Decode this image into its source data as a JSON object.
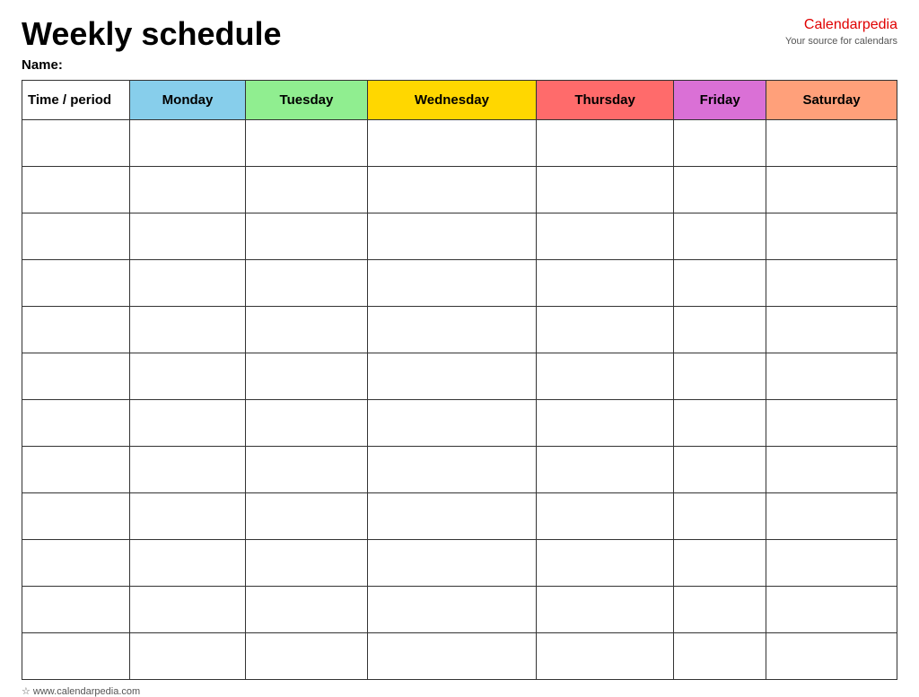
{
  "header": {
    "title": "Weekly schedule",
    "name_label": "Name:",
    "brand_name_part1": "Calendar",
    "brand_name_part2": "pedia",
    "brand_tagline": "Your source for calendars"
  },
  "table": {
    "columns": [
      {
        "key": "time",
        "label": "Time / period",
        "class": "col-time"
      },
      {
        "key": "monday",
        "label": "Monday",
        "class": "col-monday"
      },
      {
        "key": "tuesday",
        "label": "Tuesday",
        "class": "col-tuesday"
      },
      {
        "key": "wednesday",
        "label": "Wednesday",
        "class": "col-wednesday"
      },
      {
        "key": "thursday",
        "label": "Thursday",
        "class": "col-thursday"
      },
      {
        "key": "friday",
        "label": "Friday",
        "class": "col-friday"
      },
      {
        "key": "saturday",
        "label": "Saturday",
        "class": "col-saturday"
      }
    ],
    "row_count": 12
  },
  "footer": {
    "url": "www.calendarpedia.com"
  }
}
